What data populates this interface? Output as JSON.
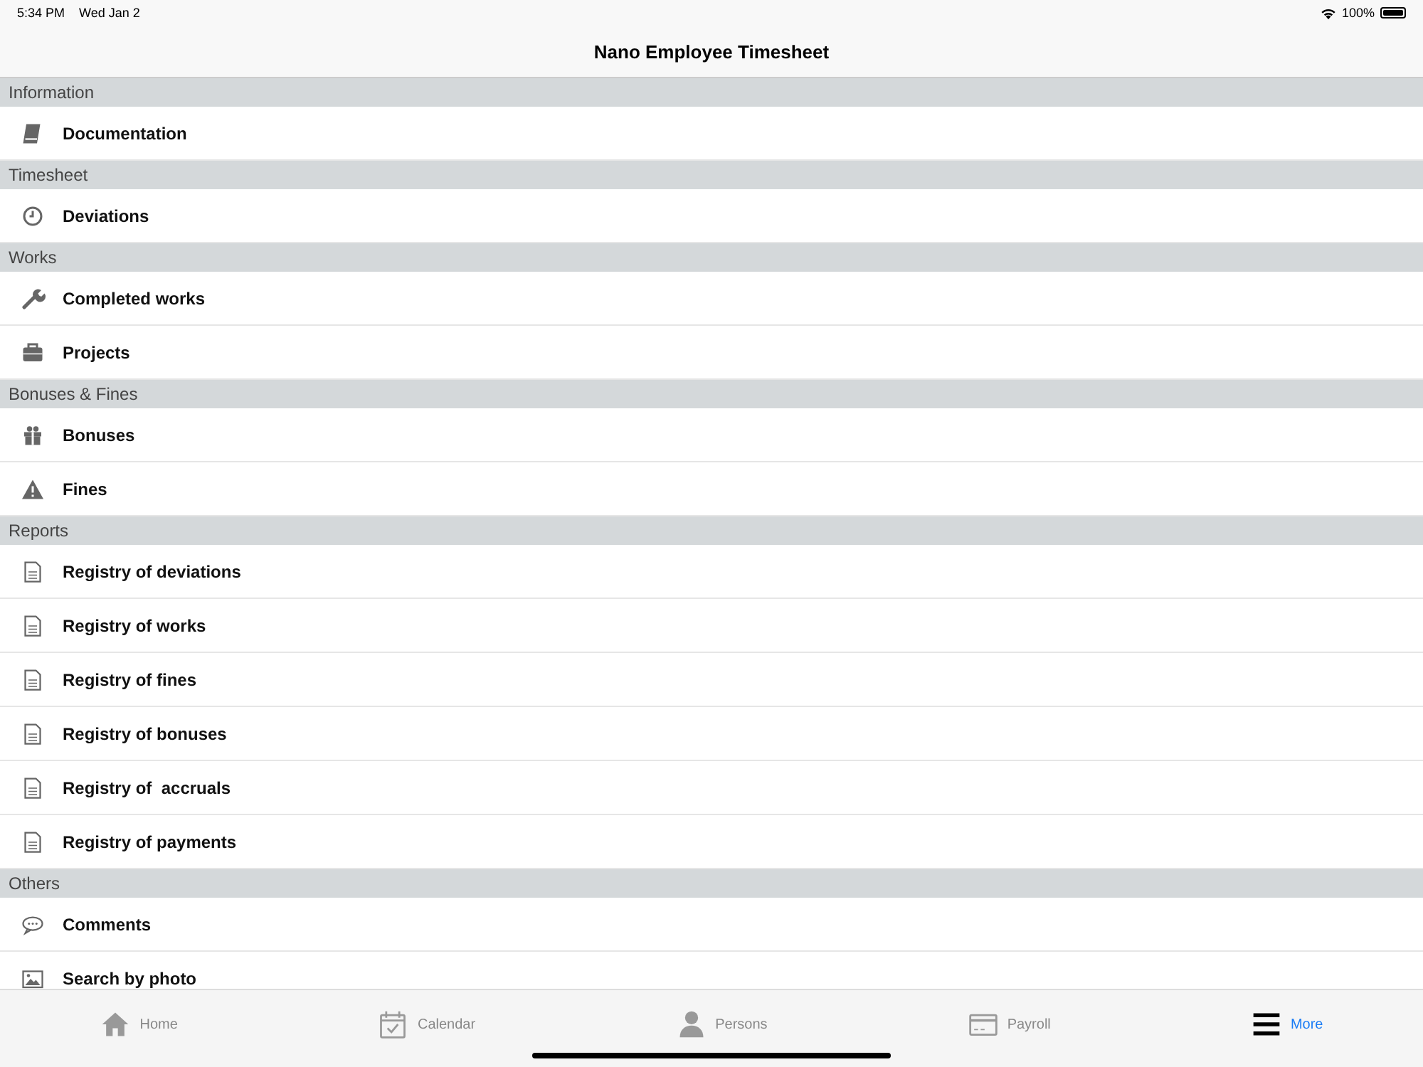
{
  "status_bar": {
    "time": "5:34 PM",
    "date": "Wed Jan 2",
    "battery": "100%"
  },
  "nav_bar": {
    "title": "Nano Employee Timesheet"
  },
  "sections": [
    {
      "title": "Information",
      "items": [
        {
          "kind": "book",
          "label": "Documentation"
        }
      ]
    },
    {
      "title": "Timesheet",
      "items": [
        {
          "kind": "clock",
          "label": "Deviations"
        }
      ]
    },
    {
      "title": "Works",
      "items": [
        {
          "kind": "wrench",
          "label": "Completed works"
        },
        {
          "kind": "briefcase",
          "label": "Projects"
        }
      ]
    },
    {
      "title": "Bonuses & Fines",
      "items": [
        {
          "kind": "gift",
          "label": "Bonuses"
        },
        {
          "kind": "warning",
          "label": "Fines"
        }
      ]
    },
    {
      "title": "Reports",
      "items": [
        {
          "kind": "document",
          "label": "Registry of deviations"
        },
        {
          "kind": "document",
          "label": "Registry of works"
        },
        {
          "kind": "document",
          "label": "Registry of fines"
        },
        {
          "kind": "document",
          "label": "Registry of bonuses"
        },
        {
          "kind": "document",
          "label": "Registry of  accruals"
        },
        {
          "kind": "document",
          "label": "Registry of payments"
        }
      ]
    },
    {
      "title": "Others",
      "items": [
        {
          "kind": "comment",
          "label": "Comments"
        },
        {
          "kind": "image",
          "label": "Search by photo"
        }
      ]
    }
  ],
  "tab_bar": [
    {
      "kind": "home",
      "label": "Home",
      "selected": false
    },
    {
      "kind": "calendar",
      "label": "Calendar",
      "selected": false
    },
    {
      "kind": "person",
      "label": "Persons",
      "selected": false
    },
    {
      "kind": "card",
      "label": "Payroll",
      "selected": false
    },
    {
      "kind": "menu",
      "label": "More",
      "selected": true
    }
  ]
}
